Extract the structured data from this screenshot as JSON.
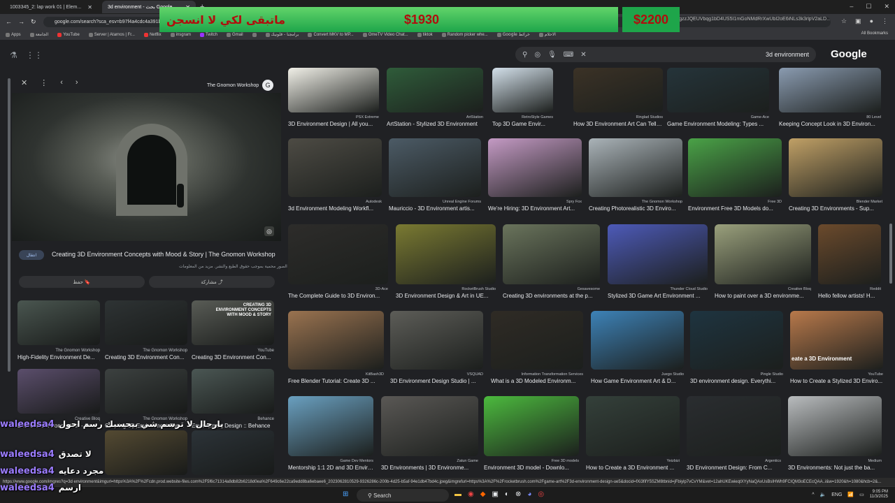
{
  "browser": {
    "tabs": [
      {
        "title": "1003345_2: lap work 01 | Elem...",
        "active": false
      },
      {
        "title": "3d environment - بحث Google",
        "active": true
      }
    ],
    "url": "google.com/search?sca_esv=b97f4a4cdc4a391b...",
    "url_tail": "e-gzzJQEUVbqg1bD4US5I1mGoNMdRrXwUbI2oE6iNLs3k3rlpV2aLD...",
    "bookmarks": [
      "Apps",
      "الجامعة",
      "YouTube",
      "Server | Atarnos | Fr...",
      "Netflix",
      "insgram",
      "Twitch",
      "Gmail",
      "",
      "برامجنا - قلونيك",
      "Convert MKV to MP...",
      "OmeTV Video Chat...",
      "tiktok",
      "Random picker whe...",
      "Google خرائط",
      "الاحلام"
    ],
    "all_bookmarks": "All Bookmarks"
  },
  "overlay": {
    "arabic": "ماتبقى لكي لا انسجن",
    "amount1": "$1930",
    "amount2": "$2200"
  },
  "google": {
    "query": "3d environment",
    "logo": "Google"
  },
  "preview": {
    "site": "The Gnomon Workshop",
    "title": "Creating 3D Environment Concepts with Mood & Story | The Gnomon Workshop",
    "subtitle": "قد تكون الصور محمية بموجب حقوق الطبع والنشر. مزيد من المعلومات",
    "visit": "انتقال",
    "save": "حفظ",
    "share": "مشاركة",
    "related": [
      {
        "source": "The Gnomon Workshop",
        "caption": "High-Fidelity Environment De...",
        "color": "#4a5650"
      },
      {
        "source": "The Gnomon Workshop",
        "caption": "Creating 3D Environment Con...",
        "color": "#2e3334"
      },
      {
        "source": "YouTube",
        "caption": "Creating 3D Environment Con...",
        "color": "#595c56",
        "overlay": "CREATING 3D ENVIRONMENT CONCEPTS WITH MOOD & STORY"
      },
      {
        "source": "Creative Bloq",
        "caption": "Environment Concept Art - Cr...",
        "color": "#5b4e6c"
      },
      {
        "source": "The Gnomon Workshop",
        "caption": "Creating 3D Environment Con...",
        "color": "#3c4140"
      },
      {
        "source": "Behance",
        "caption": "Environment Design :: Behance",
        "color": "#4b5754"
      },
      {
        "source": "",
        "caption": "",
        "color": "#544a32"
      },
      {
        "source": "",
        "caption": "",
        "color": "#2c3338"
      }
    ]
  },
  "results": [
    [
      {
        "source": "PSX Extreme",
        "caption": "3D Environment Design | All you...",
        "color": "#f1f0e8"
      },
      {
        "source": "ArtStation",
        "caption": "ArtStation - Stylized 3D Environment",
        "color": "#2f5c3a"
      },
      {
        "source": "RetroStyle Games",
        "caption": "Top 3D Game Envir...",
        "color": "#d3e0ea"
      },
      {
        "source": "Ringlad Studios",
        "caption": "How 3D Environment Art Can Tell Y...",
        "color": "#3b3226"
      },
      {
        "source": "Game-Ace",
        "caption": "Game Environment Modeling: Types ...",
        "color": "#25343a"
      },
      {
        "source": "80 Level",
        "caption": "Keeping Concept Look in 3D Environ...",
        "color": "#8a9bb0"
      }
    ],
    [
      {
        "source": "Autodesk",
        "caption": "3d Environment Modeling Workfl...",
        "color": "#4d4b44"
      },
      {
        "source": "Unreal Engine Forums",
        "caption": "Mauriccio - 3D Environment artis...",
        "color": "#4c5b66"
      },
      {
        "source": "Spry Fox",
        "caption": "We're Hiring: 3D Environment Art...",
        "color": "#c49ac4"
      },
      {
        "source": "The Gnomon Workshop",
        "caption": "Creating Photorealistic 3D Enviro...",
        "color": "#aab3b8"
      },
      {
        "source": "Free 3D",
        "caption": "Environment Free 3D Models do...",
        "color": "#4aa247"
      },
      {
        "source": "Blender Market",
        "caption": "Creating 3D Environments - Sup...",
        "color": "#c0a066"
      }
    ],
    [
      {
        "source": "3D-Ace",
        "caption": "The Complete Guide to 3D Environ...",
        "color": "#2d2c2a"
      },
      {
        "source": "RocketBrush Studio",
        "caption": "3D Environment Design & Art in UE...",
        "color": "#7a7a32"
      },
      {
        "source": "Gesavesome",
        "caption": "Creating 3D environments at the p...",
        "color": "#6a745c"
      },
      {
        "source": "Thunder Cloud Studio",
        "caption": "Stylized 3D Game Art Environment ...",
        "color": "#4d5ab8"
      },
      {
        "source": "Creative Bloq",
        "caption": "How to paint over a 3D environme...",
        "color": "#9aa07c"
      },
      {
        "source": "Reddit",
        "caption": "Hello fellow artists! H...",
        "color": "#6b4a2c"
      }
    ],
    [
      {
        "source": "KitBash3D",
        "caption": "Free Blender Tutorial: Create 3D ...",
        "color": "#9a7350"
      },
      {
        "source": "VSQUAD",
        "caption": "3D Environment Design Studio | ...",
        "color": "#5d5d58"
      },
      {
        "source": "Information Transformation Services",
        "caption": "What is a 3D Modeled Environm...",
        "color": "#2f2b25"
      },
      {
        "source": "Juego Studio",
        "caption": "How Game Environment Art & D...",
        "color": "#3d82b7"
      },
      {
        "source": "Pingle Studio",
        "caption": "3D environment design. Everythi...",
        "color": "#1e3440"
      },
      {
        "source": "YouTube",
        "caption": "How to Create a Stylized 3D Enviro...",
        "color": "#b8794b",
        "overlay": "eate a 3D Environment"
      }
    ],
    [
      {
        "source": "Game Dev Mentors",
        "caption": "Mentorship 1:1 2D and 3D Enviro...",
        "color": "#6aa0c0"
      },
      {
        "source": "Zatun Game",
        "caption": "3D Environments | 3D Environme...",
        "color": "#5a5855"
      },
      {
        "source": "Free 3D models",
        "caption": "Environment 3D model - Downlo...",
        "color": "#4cba3e"
      },
      {
        "source": "Yeizbizi",
        "caption": "How to Create a 3D Environment ...",
        "color": "#34403a"
      },
      {
        "source": "Argentics",
        "caption": "3D Environment Design: From C...",
        "color": "#2a2d30"
      },
      {
        "source": "Medium",
        "caption": "3D Environments: Not just the ba...",
        "color": "#b9bcbe"
      }
    ]
  ],
  "chat": [
    {
      "user": "waleedsa4",
      "msg": "يارجال لا ترسم شي بيحسبك رسم احول"
    },
    {
      "user": "waleedsa4",
      "msg": "لا تصدق"
    },
    {
      "user": "waleedsa4",
      "msg": "مجرد دعايه"
    },
    {
      "user": "waleedsa4",
      "msg": "ارسم"
    }
  ],
  "status_url": "https://www.google.com/imgres?q=3d environment&imgurl=https%3A%2F%2Fcdn.prod.website-files.com%2F5f6c71314a8db82b6218d0ea%2F649c6e22ca9edd8ba6ebaee6_2023062810529-9326286c-200b-4d25-b5af-94e1db47bd4c.jpeg&imgrefurl=https%3A%2F%2Frocketbrush.com%2Fgame-art%2F3d-environment-design-ue5&docid=fXi3fifY5SZM8tbnid=jFbiylp7vCvYM&vet=12ahUKEwieqtXYyNaQAxUsBsIHWh9FCIQM3oECEcQAA..i&w=1920&h=1080&hcb=2&...",
  "taskbar": {
    "search": "Search",
    "lang": "ENG",
    "time": "9:05 PM",
    "date": "11/3/2025"
  }
}
